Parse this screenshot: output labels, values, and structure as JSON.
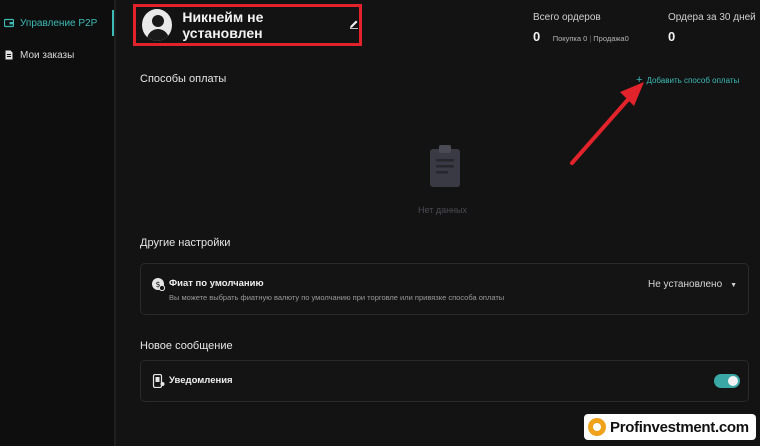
{
  "sidebar": {
    "items": [
      {
        "label": "Управление P2P",
        "icon": "wallet-icon",
        "active": true
      },
      {
        "label": "Мои заказы",
        "icon": "document-icon",
        "active": false
      }
    ]
  },
  "profile": {
    "nickname": "Никнейм не установлен",
    "edit_icon": "pencil-icon"
  },
  "stats": {
    "total_orders": {
      "label": "Всего ордеров",
      "value": "0",
      "buy": "Покупка 0",
      "sell": "Продажа0",
      "sep": "|"
    },
    "orders_30d": {
      "label": "Ордера за 30 дней",
      "value": "0"
    }
  },
  "payment_methods": {
    "title": "Способы оплаты",
    "add_label": "Добавить способ оплаты",
    "empty_text": "Нет данных"
  },
  "other_settings": {
    "title": "Другие настройки",
    "fiat": {
      "title": "Фиат по умолчанию",
      "description": "Вы можете выбрать фиатную валюту по умолчанию при торговле или привязке способа оплаты",
      "value": "Не установлено",
      "caret": "▼"
    }
  },
  "new_message": {
    "title": "Новое сообщение",
    "notifications": {
      "title": "Уведомления",
      "enabled": true
    }
  },
  "watermark": {
    "text": "Profinvestment.com"
  },
  "colors": {
    "accent": "#3dbbb6",
    "highlight": "#e3232b",
    "background": "#131313"
  }
}
